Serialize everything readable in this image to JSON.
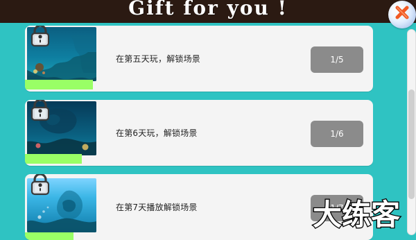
{
  "header": {
    "title": "Gift for you !"
  },
  "actions": {
    "close_icon": "close-icon"
  },
  "list": {
    "items": [
      {
        "text": "在第五天玩，解锁场景",
        "status": "1/5",
        "icon": "lock-icon",
        "progress_ratio": 0.2
      },
      {
        "text": "在第6天玩，解锁场景",
        "status": "1/6",
        "icon": "lock-icon",
        "progress_ratio": 0.1667
      },
      {
        "text": "在第7天播放解锁场景",
        "status": "1/7",
        "icon": "lock-icon",
        "progress_ratio": 0.1429
      }
    ]
  },
  "watermark": {
    "text": "大练客"
  },
  "colors": {
    "header_bg": "#2b1a12",
    "page_bg": "#2fc3c2",
    "card_bg": "#f4f4f4",
    "status_pill_bg": "#8b8b8b",
    "progress_bar": "#99ff66",
    "close_accent": "#f15a24"
  }
}
